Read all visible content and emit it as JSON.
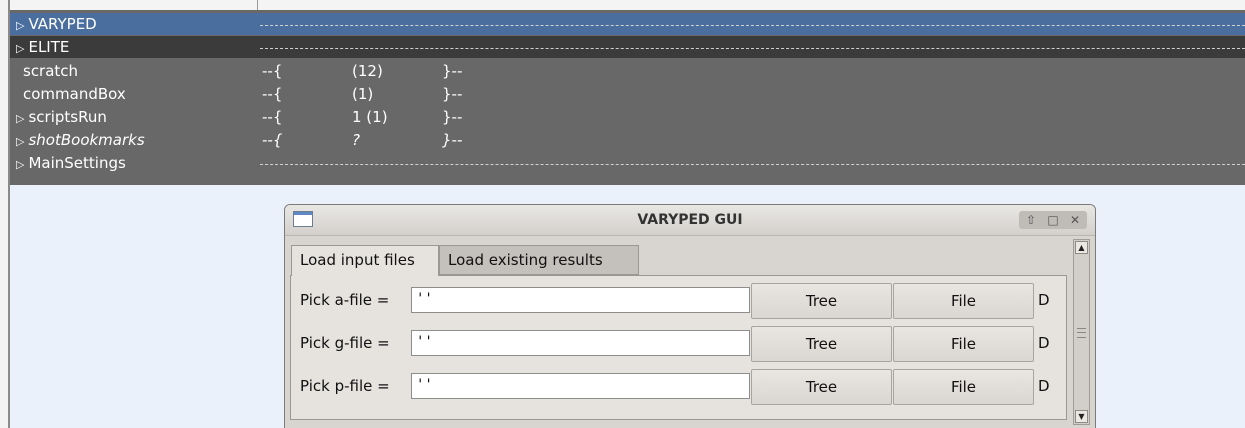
{
  "tree": {
    "rows": [
      {
        "name": "VARYPED",
        "expandable": true,
        "state": "selected"
      },
      {
        "name": "ELITE",
        "expandable": true,
        "state": "dark"
      },
      {
        "name": "scratch",
        "expandable": false,
        "brace_open": "--{",
        "value": "(12)",
        "brace_close": "}--"
      },
      {
        "name": "commandBox",
        "expandable": false,
        "brace_open": "--{",
        "value": "(1)",
        "brace_close": "}--"
      },
      {
        "name": "scriptsRun",
        "expandable": true,
        "brace_open": "--{",
        "value": "1 (1)",
        "brace_close": "}--"
      },
      {
        "name": "shotBookmarks",
        "expandable": true,
        "italic": true,
        "brace_open": "--{",
        "value": "?",
        "brace_close": "}--"
      },
      {
        "name": "MainSettings",
        "expandable": true
      }
    ],
    "expand_glyph": "▷"
  },
  "dialog": {
    "title": "VARYPED GUI",
    "controls": {
      "up": "⇧",
      "maximize": "□",
      "close": "✕"
    },
    "tabs": [
      {
        "label": "Load input files",
        "active": true
      },
      {
        "label": "Load existing results",
        "active": false
      }
    ],
    "fields": [
      {
        "label": "Pick a-file =",
        "value": "''",
        "tree_label": "Tree",
        "file_label": "File",
        "cut_label": "D"
      },
      {
        "label": "Pick g-file =",
        "value": "''",
        "tree_label": "Tree",
        "file_label": "File",
        "cut_label": "D"
      },
      {
        "label": "Pick p-file =",
        "value": "''",
        "tree_label": "Tree",
        "file_label": "File",
        "cut_label": "D"
      }
    ],
    "scroll_up": "▲",
    "scroll_down": "▼"
  },
  "colors": {
    "selected_row": "#4a6f9e",
    "tree_bg": "#686868",
    "elite_row": "#3b3b3b",
    "page_bg": "#eaf1fb"
  },
  "icons": [
    "expand-triangle-icon",
    "window-icon",
    "shade-up-icon",
    "maximize-icon",
    "close-icon",
    "scroll-up-arrow-icon",
    "scroll-down-arrow-icon"
  ]
}
